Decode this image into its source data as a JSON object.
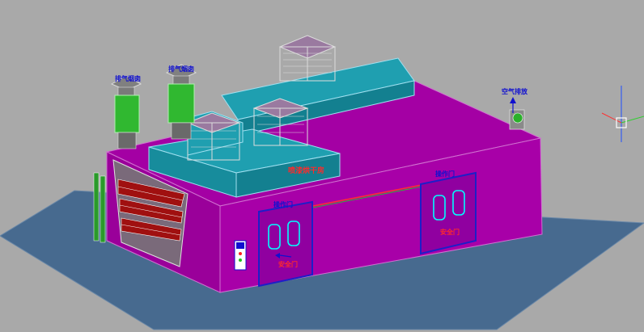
{
  "colors": {
    "background": "#a9a9a9",
    "floor": "#476a8f",
    "booth_wall": "#b000b0",
    "booth_wall_dark": "#8c008c",
    "roof": "#a400a4",
    "duct": "#1f9fb0",
    "tower": "#30b830",
    "door_frame": "#1e1ec8",
    "window_outline": "#00ffff"
  },
  "labels": {
    "exhaust_left_1": "排气烟囱",
    "exhaust_left_2": "排气烟囱",
    "air_supply": "空气排放",
    "front_banner": "喷漆烘干房",
    "door_left_title": "操作门",
    "door_right_title": "操作门",
    "door_left_sign": "安全门",
    "door_right_sign": "安全门"
  }
}
